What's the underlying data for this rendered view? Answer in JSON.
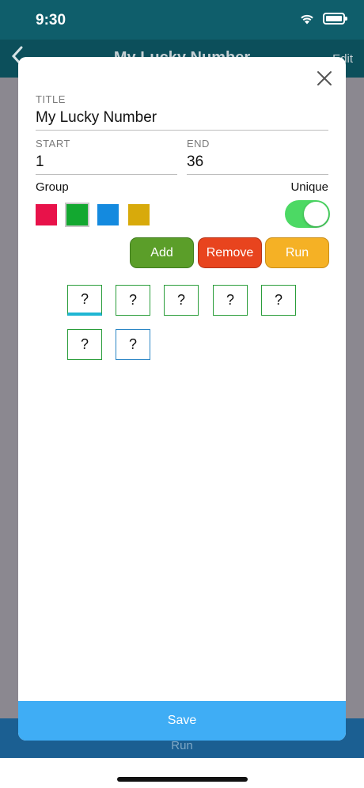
{
  "status_bar": {
    "time": "9:30"
  },
  "nav": {
    "back_icon": "chevron-left-icon",
    "title": "My Lucky Number",
    "edit": "Edit"
  },
  "bottom_bar": {
    "run": "Run"
  },
  "modal": {
    "title": {
      "label": "TITLE",
      "value": "My Lucky Number"
    },
    "start": {
      "label": "START",
      "value": "1"
    },
    "end": {
      "label": "END",
      "value": "36"
    },
    "group_label": "Group",
    "unique_label": "Unique",
    "unique_on": true,
    "group_colors": [
      "#e8124a",
      "#13a830",
      "#148adf",
      "#d8aa0b"
    ],
    "selected_group_index": 1,
    "buttons": {
      "add": {
        "label": "Add",
        "color": "#5b9e29"
      },
      "remove": {
        "label": "Remove",
        "color": "#e8441e"
      },
      "run": {
        "label": "Run",
        "color": "#f5b125"
      }
    },
    "numbers": [
      "?",
      "?",
      "?",
      "?",
      "?",
      "?",
      "?"
    ],
    "save": "Save"
  }
}
